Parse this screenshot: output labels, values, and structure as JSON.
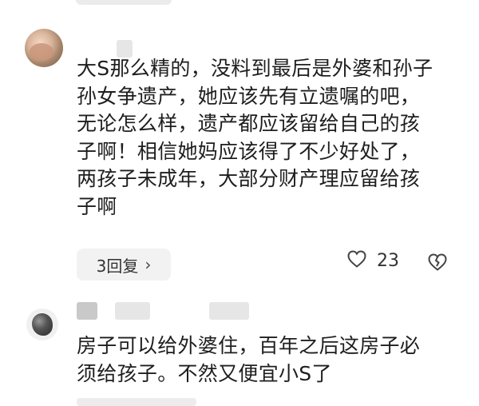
{
  "comments": [
    {
      "text": "大S那么精的，没料到最后是外婆和孙子\n孙女争遗产，她应该先有立遗嘱的吧，\n无论怎么样，遗产都应该留给自己的孩\n子啊！相信她妈应该得了不少好处了，\n两孩子未成年，大部分财产理应留给孩\n子啊",
      "replies_label": "3回复",
      "chevron": "›",
      "like_count": "23",
      "icons": [
        "heart-outline-icon",
        "broken-heart-icon",
        "chevron-right-icon"
      ]
    },
    {
      "text": "房子可以给外婆住，百年之后这房子必\n须给孩子。不然又便宜小S了"
    }
  ]
}
